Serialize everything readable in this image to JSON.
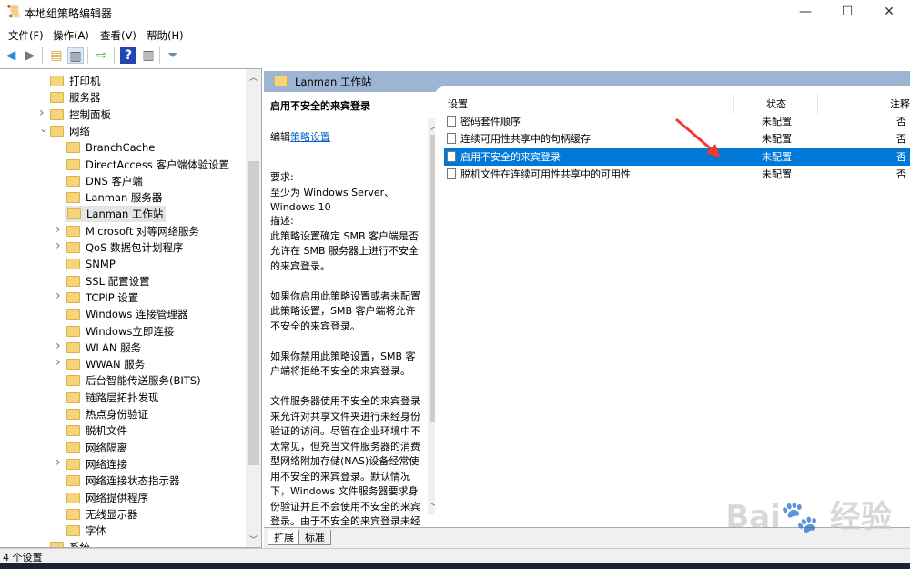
{
  "window": {
    "title": "本地组策略编辑器",
    "minimize": "—",
    "maximize": "☐",
    "close": "✕"
  },
  "menu": [
    "文件(F)",
    "操作(A)",
    "查看(V)",
    "帮助(H)"
  ],
  "toolbar": {
    "icons": [
      "back-arrow-icon",
      "forward-arrow-icon",
      "up-folder-icon",
      "show-hide-tree-icon",
      "export-list-icon",
      "help-icon",
      "show-action-pane-icon",
      "filter-icon"
    ]
  },
  "tree": {
    "items": [
      {
        "label": "打印机",
        "level": 1,
        "expandable": false
      },
      {
        "label": "服务器",
        "level": 1,
        "expandable": false
      },
      {
        "label": "控制面板",
        "level": 1,
        "expandable": true
      },
      {
        "label": "网络",
        "level": 1,
        "expandable": true,
        "expanded": true
      },
      {
        "label": "BranchCache",
        "level": 2,
        "expandable": false
      },
      {
        "label": "DirectAccess 客户端体验设置",
        "level": 2,
        "expandable": false
      },
      {
        "label": "DNS 客户端",
        "level": 2,
        "expandable": false
      },
      {
        "label": "Lanman 服务器",
        "level": 2,
        "expandable": false
      },
      {
        "label": "Lanman 工作站",
        "level": 2,
        "expandable": false,
        "selected": true
      },
      {
        "label": "Microsoft 对等网络服务",
        "level": 2,
        "expandable": true
      },
      {
        "label": "QoS 数据包计划程序",
        "level": 2,
        "expandable": true
      },
      {
        "label": "SNMP",
        "level": 2,
        "expandable": false
      },
      {
        "label": "SSL 配置设置",
        "level": 2,
        "expandable": false
      },
      {
        "label": "TCPIP 设置",
        "level": 2,
        "expandable": true
      },
      {
        "label": "Windows 连接管理器",
        "level": 2,
        "expandable": false
      },
      {
        "label": "Windows立即连接",
        "level": 2,
        "expandable": false
      },
      {
        "label": "WLAN 服务",
        "level": 2,
        "expandable": true
      },
      {
        "label": "WWAN 服务",
        "level": 2,
        "expandable": true
      },
      {
        "label": "后台智能传送服务(BITS)",
        "level": 2,
        "expandable": false
      },
      {
        "label": "链路层拓扑发现",
        "level": 2,
        "expandable": false
      },
      {
        "label": "热点身份验证",
        "level": 2,
        "expandable": false
      },
      {
        "label": "脱机文件",
        "level": 2,
        "expandable": false
      },
      {
        "label": "网络隔离",
        "level": 2,
        "expandable": false
      },
      {
        "label": "网络连接",
        "level": 2,
        "expandable": true
      },
      {
        "label": "网络连接状态指示器",
        "level": 2,
        "expandable": false
      },
      {
        "label": "网络提供程序",
        "level": 2,
        "expandable": false
      },
      {
        "label": "无线显示器",
        "level": 2,
        "expandable": false
      },
      {
        "label": "字体",
        "level": 2,
        "expandable": false
      },
      {
        "label": "系统",
        "level": 1,
        "expandable": false
      }
    ]
  },
  "header": {
    "title": "Lanman 工作站"
  },
  "description": {
    "title": "启用不安全的来宾登录",
    "edit_prefix": "编辑",
    "edit_link": "策略设置",
    "requirements": "要求:\n至少为 Windows Server、Windows 10",
    "body": "描述:\n此策略设置确定 SMB 客户端是否允许在 SMB 服务器上进行不安全的来宾登录。\n\n如果你启用此策略设置或者未配置此策略设置，SMB 客户端将允许不安全的来宾登录。\n\n如果你禁用此策略设置，SMB 客户端将拒绝不安全的来宾登录。\n\n文件服务器使用不安全的来宾登录来允许对共享文件夹进行未经身份验证的访问。尽管在企业环境中不太常见，但充当文件服务器的消费型网络附加存储(NAS)设备经常使用不安全的来宾登录。默认情况下，Windows 文件服务器要求身份验证并且不会使用不安全的来宾登录。由于不安全的来宾登录未经过身份验证，重要的安全功能(例"
  },
  "list": {
    "columns": [
      "设置",
      "状态",
      "注释"
    ],
    "rows": [
      {
        "setting": "密码套件顺序",
        "state": "未配置",
        "comment": "否"
      },
      {
        "setting": "连续可用性共享中的句柄缓存",
        "state": "未配置",
        "comment": "否"
      },
      {
        "setting": "启用不安全的来宾登录",
        "state": "未配置",
        "comment": "否",
        "selected": true
      },
      {
        "setting": "脱机文件在连续可用性共享中的可用性",
        "state": "未配置",
        "comment": "否"
      }
    ]
  },
  "tabs": [
    "扩展",
    "标准"
  ],
  "status": "4 个设置",
  "colors": {
    "selection": "#0078d7",
    "header_band": "#9db5d2",
    "annotation_arrow": "#f03a2e"
  },
  "watermark": "Bai du 经验"
}
